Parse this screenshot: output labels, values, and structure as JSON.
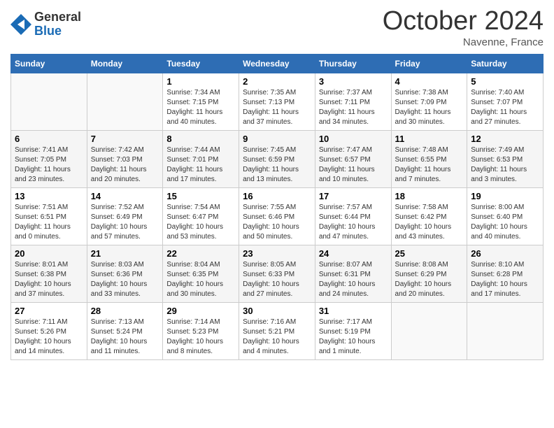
{
  "header": {
    "logo_general": "General",
    "logo_blue": "Blue",
    "month_title": "October 2024",
    "location": "Navenne, France"
  },
  "days_of_week": [
    "Sunday",
    "Monday",
    "Tuesday",
    "Wednesday",
    "Thursday",
    "Friday",
    "Saturday"
  ],
  "weeks": [
    [
      {
        "day": "",
        "sunrise": "",
        "sunset": "",
        "daylight": ""
      },
      {
        "day": "",
        "sunrise": "",
        "sunset": "",
        "daylight": ""
      },
      {
        "day": "1",
        "sunrise": "Sunrise: 7:34 AM",
        "sunset": "Sunset: 7:15 PM",
        "daylight": "Daylight: 11 hours and 40 minutes."
      },
      {
        "day": "2",
        "sunrise": "Sunrise: 7:35 AM",
        "sunset": "Sunset: 7:13 PM",
        "daylight": "Daylight: 11 hours and 37 minutes."
      },
      {
        "day": "3",
        "sunrise": "Sunrise: 7:37 AM",
        "sunset": "Sunset: 7:11 PM",
        "daylight": "Daylight: 11 hours and 34 minutes."
      },
      {
        "day": "4",
        "sunrise": "Sunrise: 7:38 AM",
        "sunset": "Sunset: 7:09 PM",
        "daylight": "Daylight: 11 hours and 30 minutes."
      },
      {
        "day": "5",
        "sunrise": "Sunrise: 7:40 AM",
        "sunset": "Sunset: 7:07 PM",
        "daylight": "Daylight: 11 hours and 27 minutes."
      }
    ],
    [
      {
        "day": "6",
        "sunrise": "Sunrise: 7:41 AM",
        "sunset": "Sunset: 7:05 PM",
        "daylight": "Daylight: 11 hours and 23 minutes."
      },
      {
        "day": "7",
        "sunrise": "Sunrise: 7:42 AM",
        "sunset": "Sunset: 7:03 PM",
        "daylight": "Daylight: 11 hours and 20 minutes."
      },
      {
        "day": "8",
        "sunrise": "Sunrise: 7:44 AM",
        "sunset": "Sunset: 7:01 PM",
        "daylight": "Daylight: 11 hours and 17 minutes."
      },
      {
        "day": "9",
        "sunrise": "Sunrise: 7:45 AM",
        "sunset": "Sunset: 6:59 PM",
        "daylight": "Daylight: 11 hours and 13 minutes."
      },
      {
        "day": "10",
        "sunrise": "Sunrise: 7:47 AM",
        "sunset": "Sunset: 6:57 PM",
        "daylight": "Daylight: 11 hours and 10 minutes."
      },
      {
        "day": "11",
        "sunrise": "Sunrise: 7:48 AM",
        "sunset": "Sunset: 6:55 PM",
        "daylight": "Daylight: 11 hours and 7 minutes."
      },
      {
        "day": "12",
        "sunrise": "Sunrise: 7:49 AM",
        "sunset": "Sunset: 6:53 PM",
        "daylight": "Daylight: 11 hours and 3 minutes."
      }
    ],
    [
      {
        "day": "13",
        "sunrise": "Sunrise: 7:51 AM",
        "sunset": "Sunset: 6:51 PM",
        "daylight": "Daylight: 11 hours and 0 minutes."
      },
      {
        "day": "14",
        "sunrise": "Sunrise: 7:52 AM",
        "sunset": "Sunset: 6:49 PM",
        "daylight": "Daylight: 10 hours and 57 minutes."
      },
      {
        "day": "15",
        "sunrise": "Sunrise: 7:54 AM",
        "sunset": "Sunset: 6:47 PM",
        "daylight": "Daylight: 10 hours and 53 minutes."
      },
      {
        "day": "16",
        "sunrise": "Sunrise: 7:55 AM",
        "sunset": "Sunset: 6:46 PM",
        "daylight": "Daylight: 10 hours and 50 minutes."
      },
      {
        "day": "17",
        "sunrise": "Sunrise: 7:57 AM",
        "sunset": "Sunset: 6:44 PM",
        "daylight": "Daylight: 10 hours and 47 minutes."
      },
      {
        "day": "18",
        "sunrise": "Sunrise: 7:58 AM",
        "sunset": "Sunset: 6:42 PM",
        "daylight": "Daylight: 10 hours and 43 minutes."
      },
      {
        "day": "19",
        "sunrise": "Sunrise: 8:00 AM",
        "sunset": "Sunset: 6:40 PM",
        "daylight": "Daylight: 10 hours and 40 minutes."
      }
    ],
    [
      {
        "day": "20",
        "sunrise": "Sunrise: 8:01 AM",
        "sunset": "Sunset: 6:38 PM",
        "daylight": "Daylight: 10 hours and 37 minutes."
      },
      {
        "day": "21",
        "sunrise": "Sunrise: 8:03 AM",
        "sunset": "Sunset: 6:36 PM",
        "daylight": "Daylight: 10 hours and 33 minutes."
      },
      {
        "day": "22",
        "sunrise": "Sunrise: 8:04 AM",
        "sunset": "Sunset: 6:35 PM",
        "daylight": "Daylight: 10 hours and 30 minutes."
      },
      {
        "day": "23",
        "sunrise": "Sunrise: 8:05 AM",
        "sunset": "Sunset: 6:33 PM",
        "daylight": "Daylight: 10 hours and 27 minutes."
      },
      {
        "day": "24",
        "sunrise": "Sunrise: 8:07 AM",
        "sunset": "Sunset: 6:31 PM",
        "daylight": "Daylight: 10 hours and 24 minutes."
      },
      {
        "day": "25",
        "sunrise": "Sunrise: 8:08 AM",
        "sunset": "Sunset: 6:29 PM",
        "daylight": "Daylight: 10 hours and 20 minutes."
      },
      {
        "day": "26",
        "sunrise": "Sunrise: 8:10 AM",
        "sunset": "Sunset: 6:28 PM",
        "daylight": "Daylight: 10 hours and 17 minutes."
      }
    ],
    [
      {
        "day": "27",
        "sunrise": "Sunrise: 7:11 AM",
        "sunset": "Sunset: 5:26 PM",
        "daylight": "Daylight: 10 hours and 14 minutes."
      },
      {
        "day": "28",
        "sunrise": "Sunrise: 7:13 AM",
        "sunset": "Sunset: 5:24 PM",
        "daylight": "Daylight: 10 hours and 11 minutes."
      },
      {
        "day": "29",
        "sunrise": "Sunrise: 7:14 AM",
        "sunset": "Sunset: 5:23 PM",
        "daylight": "Daylight: 10 hours and 8 minutes."
      },
      {
        "day": "30",
        "sunrise": "Sunrise: 7:16 AM",
        "sunset": "Sunset: 5:21 PM",
        "daylight": "Daylight: 10 hours and 4 minutes."
      },
      {
        "day": "31",
        "sunrise": "Sunrise: 7:17 AM",
        "sunset": "Sunset: 5:19 PM",
        "daylight": "Daylight: 10 hours and 1 minute."
      },
      {
        "day": "",
        "sunrise": "",
        "sunset": "",
        "daylight": ""
      },
      {
        "day": "",
        "sunrise": "",
        "sunset": "",
        "daylight": ""
      }
    ]
  ]
}
